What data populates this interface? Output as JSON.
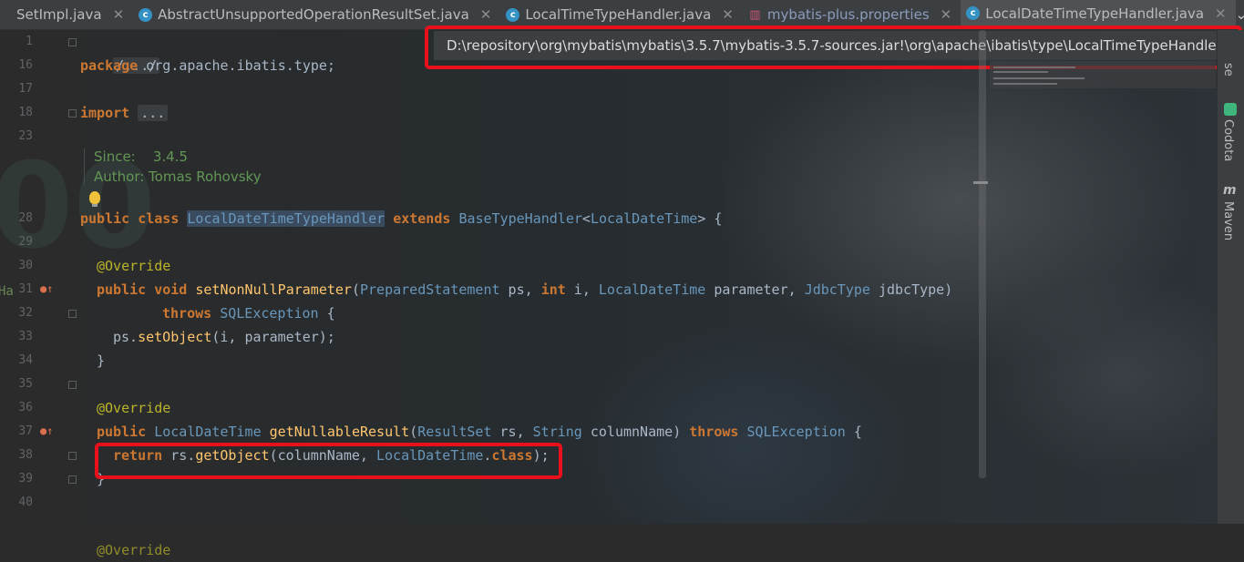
{
  "tabs": [
    {
      "label": "SetImpl.java",
      "icon": "none"
    },
    {
      "label": "AbstractUnsupportedOperationResultSet.java",
      "icon": "class-icon"
    },
    {
      "label": "LocalTimeTypeHandler.java",
      "icon": "class-icon"
    },
    {
      "label": "mybatis-plus.properties",
      "icon": "properties-icon"
    },
    {
      "label": "LocalDateTimeTypeHandler.java",
      "icon": "class-icon",
      "active": true
    }
  ],
  "path_tooltip": "D:\\repository\\org\\mybatis\\mybatis\\3.5.7\\mybatis-3.5.7-sources.jar!\\org\\apache\\ibatis\\type\\LocalTimeTypeHandler.jav",
  "gutter": {
    "line_numbers": [
      "1",
      "16",
      "17",
      "18",
      "23",
      "28",
      "29",
      "30",
      "31",
      "32",
      "33",
      "34",
      "35",
      "36",
      "37",
      "38",
      "39",
      "40"
    ],
    "side_text": "Ha"
  },
  "code": {
    "l1_folded": "/.../",
    "l16_kw": "package",
    "l16_pkg": "org.apache.ibatis.type;",
    "l18_kw": "import",
    "l18_folded": "...",
    "doc_since_label": "Since:",
    "doc_since_value": "3.4.5",
    "doc_author": "Author: Tomas Rohovsky",
    "l28_public": "public",
    "l28_class": "class",
    "l28_name": "LocalDateTimeTypeHandler",
    "l28_extends": "extends",
    "l28_base": "BaseTypeHandler",
    "l28_lt": "<",
    "l28_generic": "LocalDateTime",
    "l28_gt": ">",
    "l28_brace": " {",
    "override": "@Override",
    "l31_public": "public",
    "l31_void": "void",
    "l31_method": "setNonNullParameter",
    "l31_rest_a": "(",
    "l31_t1": "PreparedStatement",
    "l31_p1": " ps, ",
    "l31_int": "int",
    "l31_p2": " i, ",
    "l31_t3": "LocalDateTime",
    "l31_p3": " parameter, ",
    "l31_t4": "JdbcType",
    "l31_p4": " jdbcType",
    "l31_close": ")",
    "l32_throws": "throws",
    "l32_exc": "SQLException",
    "l32_brace": " {",
    "l33_a": "ps.",
    "l33_method": "setObject",
    "l33_b": "(i, parameter);",
    "close_brace": "}",
    "l37_public": "public",
    "l37_type": "LocalDateTime",
    "l37_method": "getNullableResult",
    "l37_open": "(",
    "l37_t1": "ResultSet",
    "l37_p1": " rs, ",
    "l37_t2": "String",
    "l37_p2": " columnName",
    "l37_close": ")",
    "l37_throws": "throws",
    "l37_exc": "SQLException",
    "l37_brace": " {",
    "l38_return": "return",
    "l38_a": " rs.",
    "l38_method": "getObject",
    "l38_b": "(columnName, ",
    "l38_type": "LocalDateTime",
    "l38_dot": ".",
    "l38_class": "class",
    "l38_end": ");",
    "l41_partial": "@Override"
  },
  "right_tools": {
    "top_partial": "se",
    "codota": "Codota",
    "maven": "Maven"
  },
  "colors": {
    "keyword": "#cc7832",
    "type": "#6897bb",
    "annotation": "#bbb529",
    "method": "#ffc66d",
    "doc": "#629755",
    "highlight_box": "#e8101a"
  }
}
